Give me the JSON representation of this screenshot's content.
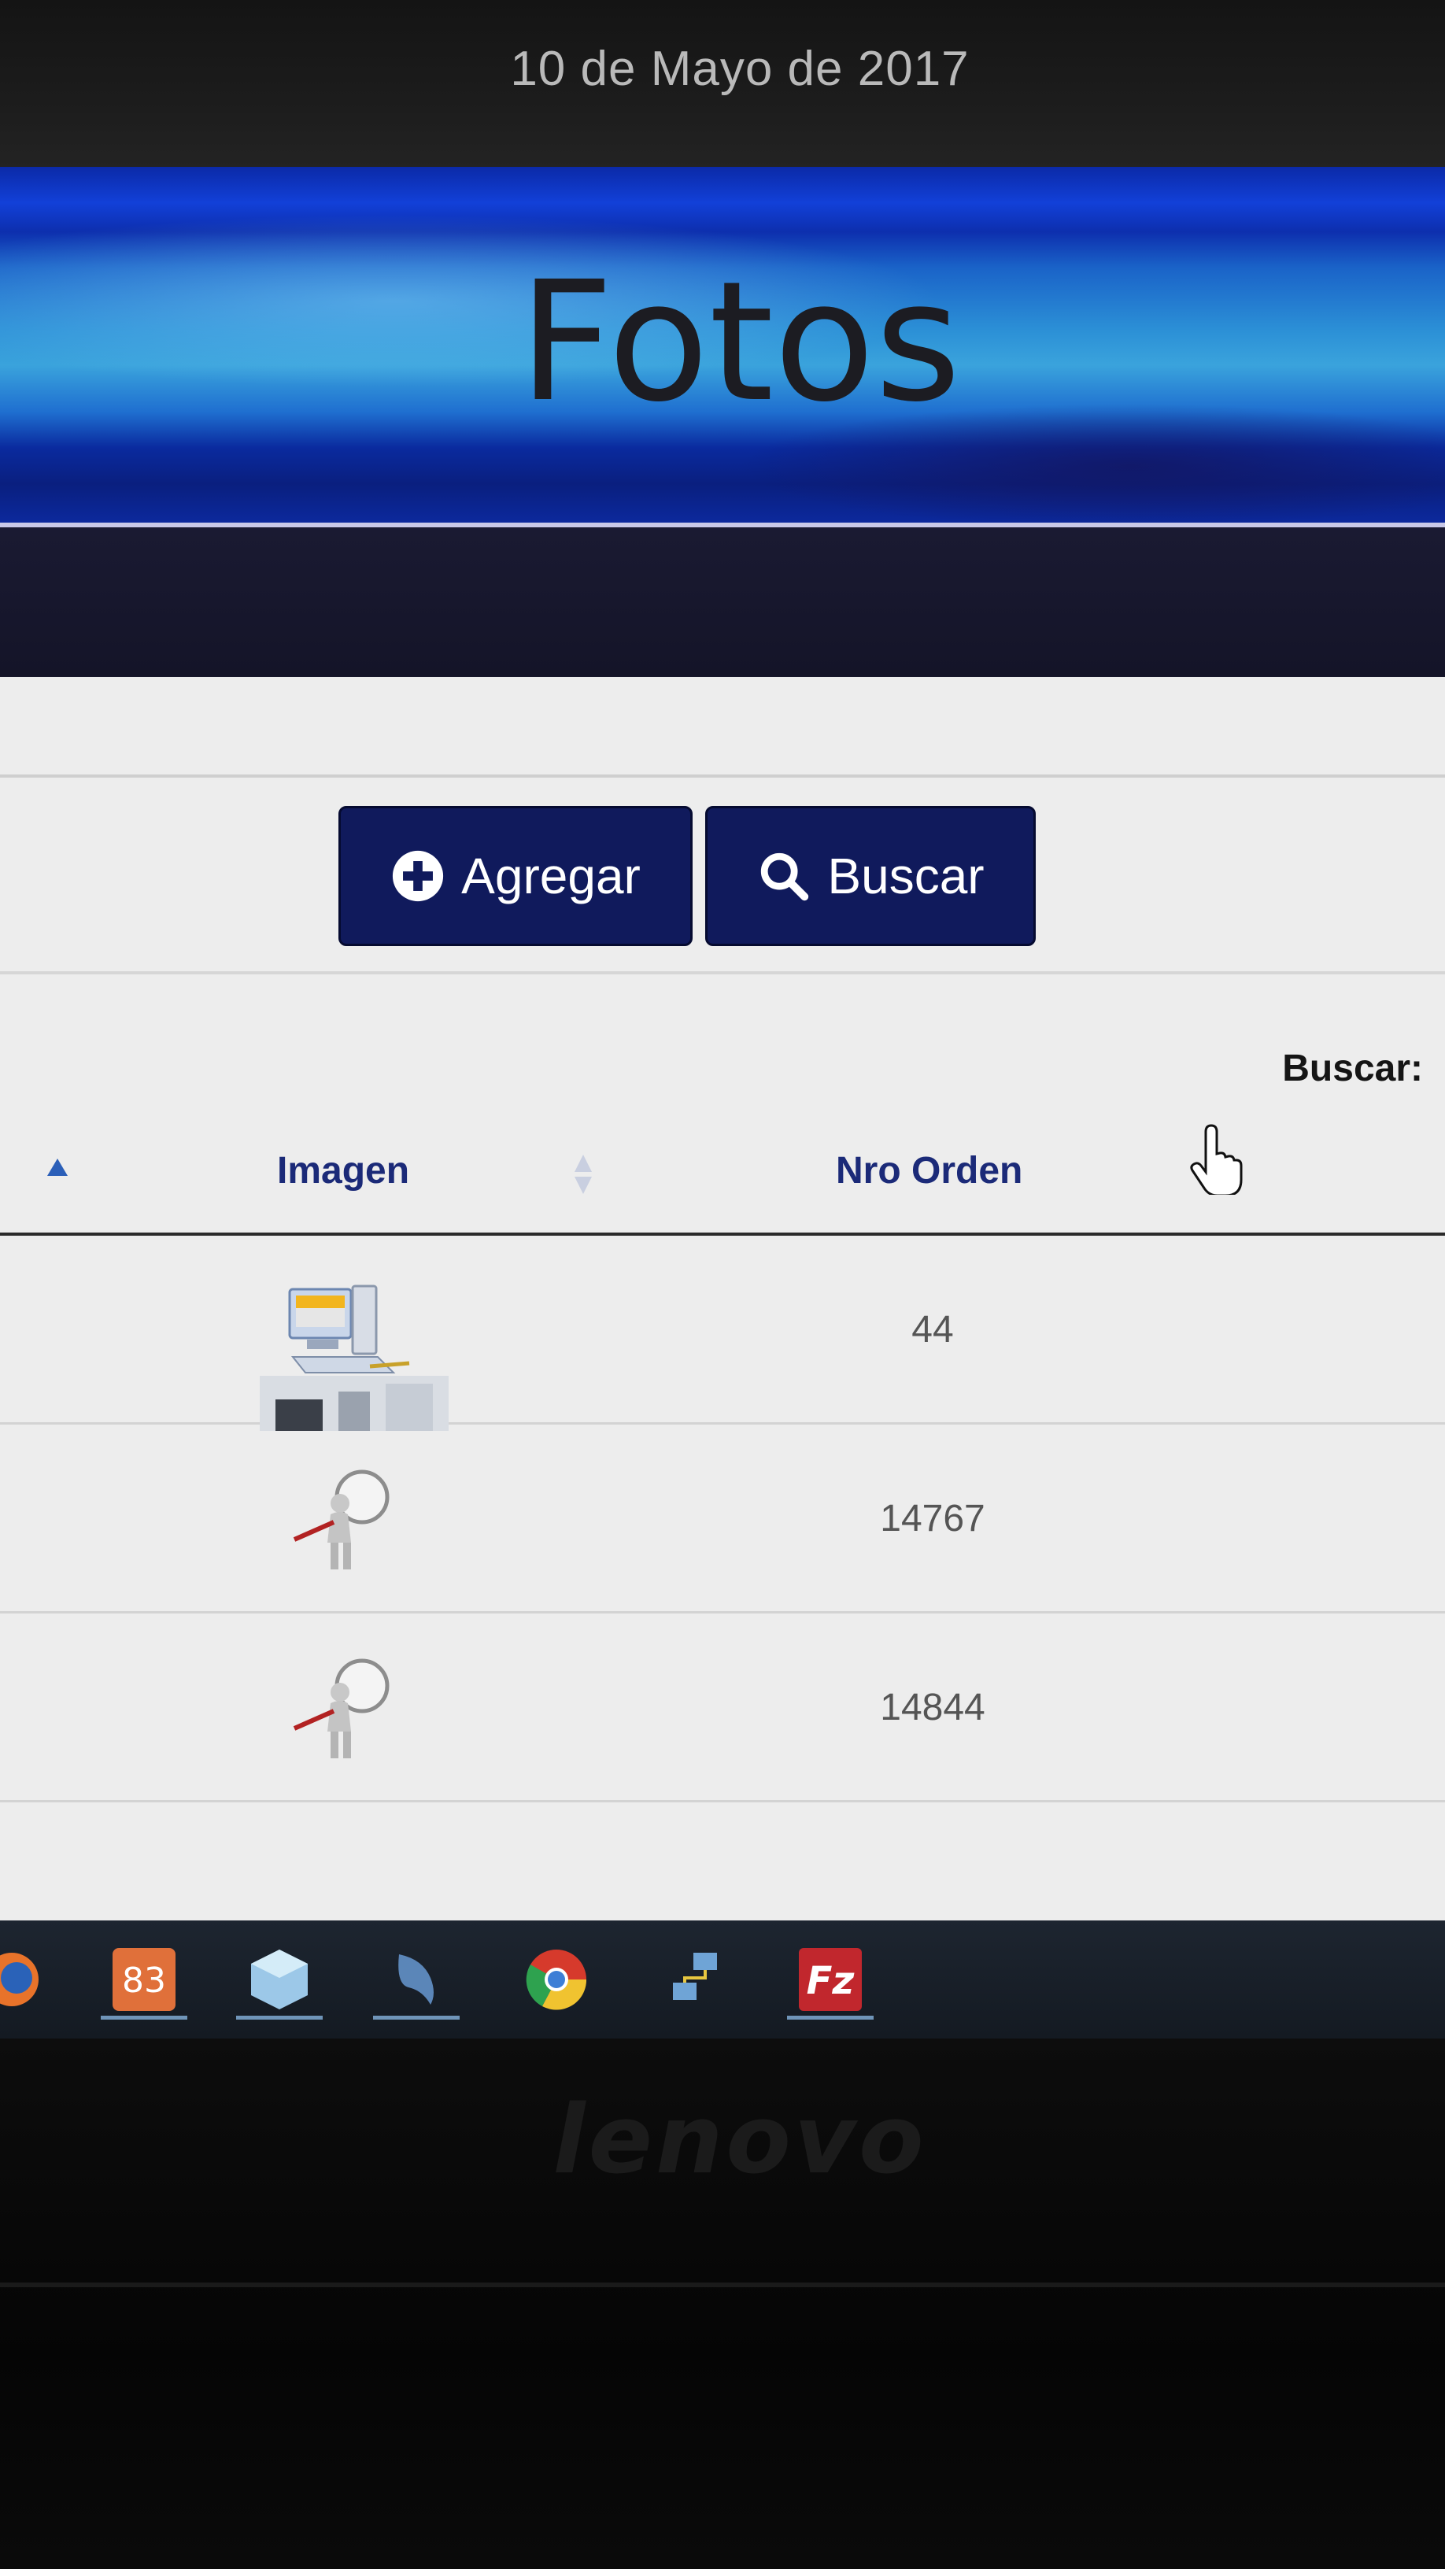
{
  "header": {
    "date": "10 de Mayo de 2017",
    "title": "Fotos"
  },
  "toolbar": {
    "add_label": "Agregar",
    "search_label": "Buscar"
  },
  "table": {
    "search_label": "Buscar:",
    "columns": [
      "Imagen",
      "Nro Orden"
    ],
    "rows": [
      {
        "image": "computer-icon",
        "order": "44"
      },
      {
        "image": "magnifier-figure-icon",
        "order": "14767"
      },
      {
        "image": "magnifier-figure-icon",
        "order": "14844"
      }
    ]
  },
  "taskbar": {
    "items": [
      "firefox-icon",
      "xampp-icon",
      "virtualbox-icon",
      "mysql-workbench-icon",
      "chrome-icon",
      "network-icon",
      "filezilla-icon"
    ]
  },
  "bezel": {
    "brand": "lenovo"
  },
  "colors": {
    "button_bg": "#101a5c",
    "header_text": "#1b2a78",
    "banner_blue": "#1240d8"
  }
}
